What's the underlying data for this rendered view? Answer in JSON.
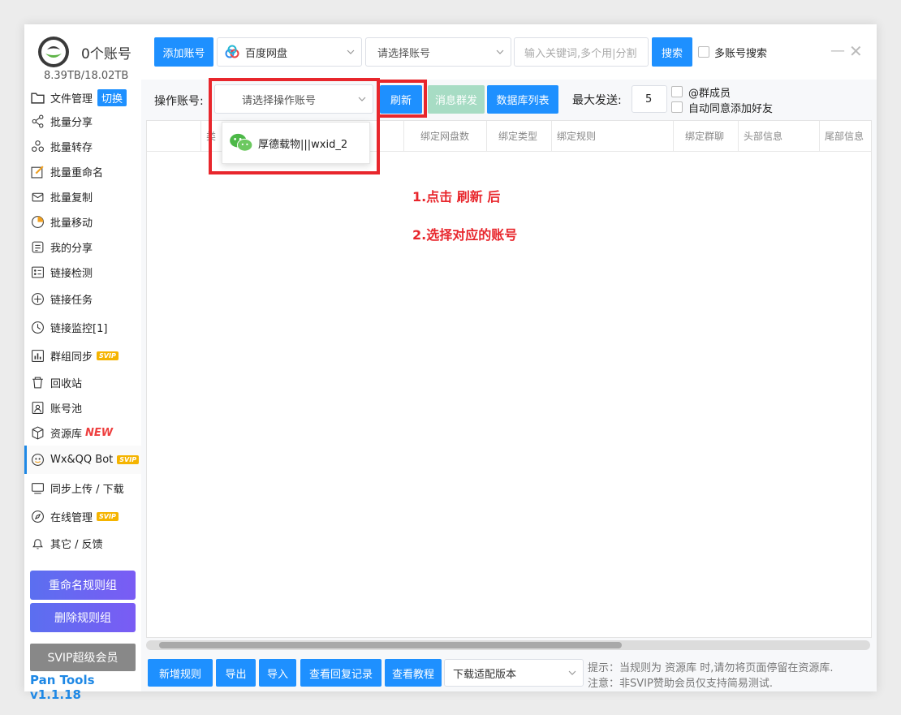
{
  "sidebar": {
    "account_count": "0个账号",
    "storage": "8.39TB/18.02TB",
    "switch_label": "切换",
    "items": [
      {
        "label": "文件管理",
        "icon": "folder-icon"
      },
      {
        "label": "批量分享",
        "icon": "share-icon"
      },
      {
        "label": "批量转存",
        "icon": "transfer-icon"
      },
      {
        "label": "批量重命名",
        "icon": "rename-icon"
      },
      {
        "label": "批量复制",
        "icon": "copy-icon"
      },
      {
        "label": "批量移动",
        "icon": "move-icon"
      },
      {
        "label": "我的分享",
        "icon": "my-share-icon"
      },
      {
        "label": "链接检测",
        "icon": "link-check-icon"
      },
      {
        "label": "链接任务",
        "icon": "link-task-icon"
      },
      {
        "label": "链接监控[1]",
        "icon": "link-monitor-icon"
      },
      {
        "label": "群组同步",
        "icon": "group-sync-icon",
        "tag": "SVIP"
      },
      {
        "label": "回收站",
        "icon": "trash-icon"
      },
      {
        "label": "账号池",
        "icon": "account-pool-icon"
      },
      {
        "label": "资源库",
        "icon": "resource-icon",
        "new": "NEW"
      },
      {
        "label": "Wx&QQ Bot",
        "icon": "bot-icon",
        "tag": "SVIP"
      },
      {
        "label": "同步上传 / 下载",
        "icon": "sync-icon"
      },
      {
        "label": "在线管理",
        "icon": "online-icon",
        "tag": "SVIP"
      },
      {
        "label": "其它 / 反馈",
        "icon": "bell-icon"
      }
    ],
    "rename_rule_btn": "重命名规则组",
    "delete_rule_btn": "删除规则组",
    "svip_btn": "SVIP超级会员",
    "version": "Pan Tools v1.1.18"
  },
  "toolbar": {
    "add_account": "添加账号",
    "cloud_select": "百度网盘",
    "account_select": "请选择账号",
    "keyword_placeholder": "输入关键词,多个用|分割",
    "search": "搜索",
    "multi_account_search": "多账号搜索"
  },
  "subbar": {
    "op_account_label": "操作账号:",
    "op_account_select": "请选择操作账号",
    "refresh": "刷新",
    "broadcast": "消息群发",
    "db_list": "数据库列表",
    "max_send_label": "最大发送:",
    "max_send_value": "5",
    "at_members": "@群成员",
    "auto_accept": "自动同意添加好友"
  },
  "dropdown": {
    "option": "厚德载物|||wxid_2"
  },
  "table": {
    "headers": [
      "类",
      "绑定网盘数",
      "绑定类型",
      "绑定规则",
      "绑定群聊",
      "头部信息",
      "尾部信息"
    ]
  },
  "annotations": {
    "step1": "1.点击 刷新 后",
    "step2": "2.选择对应的账号"
  },
  "bottom": {
    "add_rule": "新增规则",
    "export": "导出",
    "import": "导入",
    "reply_log": "查看回复记录",
    "tutorial": "查看教程",
    "download_select": "下载适配版本",
    "tip1": "提示：当规则为 资源库 时,请勿将页面停留在资源库.",
    "tip2": "注意：非SVIP赞助会员仅支持简易测试."
  }
}
